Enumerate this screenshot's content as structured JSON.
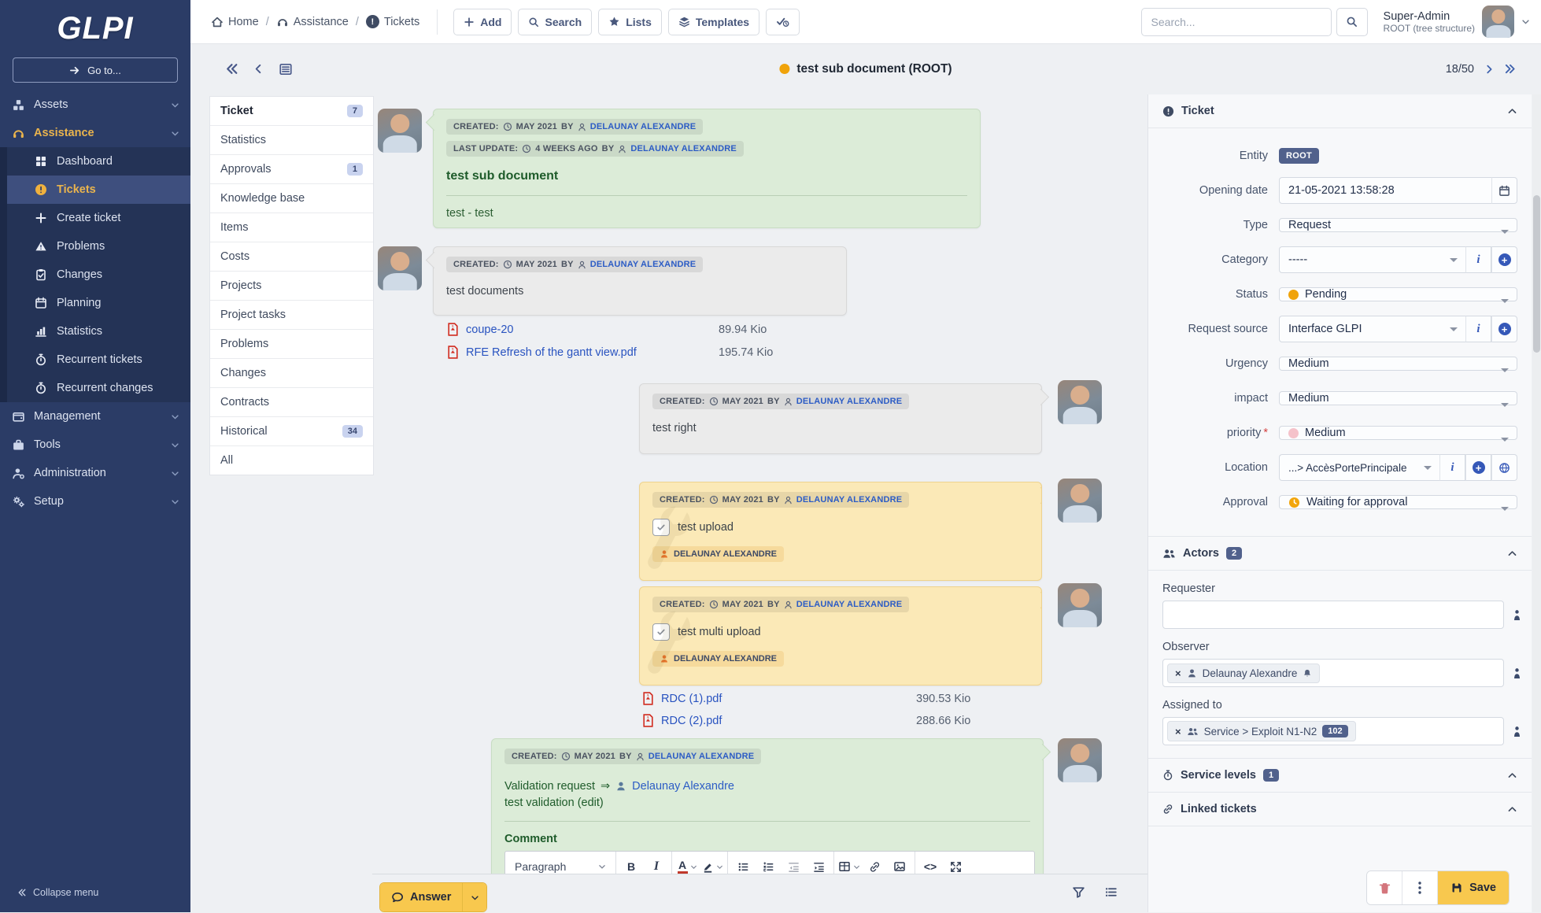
{
  "colors": {
    "accent_orange": "#f0a30a",
    "priority_pink": "#f5c2ca",
    "save_yellow": "#f8c84e",
    "link_blue": "#2c5cc5",
    "sidebar_navy": "#2b3c66",
    "green_text": "#1e5b2a"
  },
  "sidebar": {
    "logo": "GLPI",
    "goto": "Go to...",
    "collapse": "Collapse menu",
    "items": [
      {
        "label": "Assets",
        "icon": "boxes-icon"
      },
      {
        "label": "Assistance",
        "icon": "headset-icon"
      },
      {
        "label": "Management",
        "icon": "wallet-icon"
      },
      {
        "label": "Tools",
        "icon": "briefcase-icon"
      },
      {
        "label": "Administration",
        "icon": "person-gear-icon"
      },
      {
        "label": "Setup",
        "icon": "gears-icon"
      }
    ],
    "assistance_children": [
      {
        "label": "Dashboard",
        "icon": "grid-icon"
      },
      {
        "label": "Tickets",
        "icon": "exclamation-circle-icon"
      },
      {
        "label": "Create ticket",
        "icon": "plus-icon"
      },
      {
        "label": "Problems",
        "icon": "warning-icon"
      },
      {
        "label": "Changes",
        "icon": "clipboard-check-icon"
      },
      {
        "label": "Planning",
        "icon": "calendar-icon"
      },
      {
        "label": "Statistics",
        "icon": "bar-chart-icon"
      },
      {
        "label": "Recurrent tickets",
        "icon": "stopwatch-icon"
      },
      {
        "label": "Recurrent changes",
        "icon": "stopwatch-icon"
      }
    ]
  },
  "header": {
    "breadcrumb": [
      {
        "label": "Home",
        "icon": "home-icon"
      },
      {
        "label": "Assistance",
        "icon": "headset-icon"
      },
      {
        "label": "Tickets",
        "icon": "exclamation-circle-icon"
      }
    ],
    "buttons": [
      {
        "label": "Add",
        "icon": "plus-icon"
      },
      {
        "label": "Search",
        "icon": "search-icon"
      },
      {
        "label": "Lists",
        "icon": "star-icon"
      },
      {
        "label": "Templates",
        "icon": "layers-icon"
      }
    ],
    "search_placeholder": "Search...",
    "user_name": "Super-Admin",
    "user_context": "ROOT (tree structure)"
  },
  "titlebar": {
    "title": "test sub document (ROOT)",
    "pagination": "18/50"
  },
  "tabs": [
    {
      "label": "Ticket",
      "badge": "7"
    },
    {
      "label": "Statistics",
      "badge": ""
    },
    {
      "label": "Approvals",
      "badge": "1"
    },
    {
      "label": "Knowledge base",
      "badge": ""
    },
    {
      "label": "Items",
      "badge": ""
    },
    {
      "label": "Costs",
      "badge": ""
    },
    {
      "label": "Projects",
      "badge": ""
    },
    {
      "label": "Project tasks",
      "badge": ""
    },
    {
      "label": "Problems",
      "badge": ""
    },
    {
      "label": "Changes",
      "badge": ""
    },
    {
      "label": "Contracts",
      "badge": ""
    },
    {
      "label": "Historical",
      "badge": "34"
    },
    {
      "label": "All",
      "badge": ""
    }
  ],
  "meta": {
    "created": "CREATED:",
    "by": "BY",
    "last_update": "LAST UPDATE:",
    "time_created": "MAY 2021",
    "time_update": "4 WEEKS AGO",
    "author": "DELAUNAY ALEXANDRE"
  },
  "cards": {
    "doc": {
      "title": "test sub document",
      "body": "test - test"
    },
    "documents": {
      "body": "test documents",
      "a1_name": "coupe-20",
      "a1_size": "89.94 Kio",
      "a2_name": "RFE Refresh of the gantt view.pdf",
      "a2_size": "195.74 Kio"
    },
    "right": {
      "body": "test right"
    },
    "task1": {
      "body": "test upload",
      "footer": "DELAUNAY ALEXANDRE"
    },
    "task2": {
      "body": "test multi upload",
      "footer": "DELAUNAY ALEXANDRE",
      "a1_name": "RDC (1).pdf",
      "a1_size": "390.53 Kio",
      "a2_name": "RDC (2).pdf",
      "a2_size": "288.66 Kio"
    },
    "validation": {
      "line1": "Validation request",
      "arrow": "⇒",
      "target": "Delaunay Alexandre",
      "line2": "test validation (edit)",
      "comment": "Comment"
    }
  },
  "editor": {
    "paragraph": "Paragraph"
  },
  "actions": {
    "answer": "Answer",
    "save": "Save"
  },
  "panel": {
    "ticket": {
      "title": "Ticket",
      "entity_label": "Entity",
      "entity": "ROOT",
      "opening_label": "Opening date",
      "opening": "21-05-2021 13:58:28",
      "type_label": "Type",
      "type": "Request",
      "category_label": "Category",
      "category": "-----",
      "status_label": "Status",
      "status": "Pending",
      "source_label": "Request source",
      "source": "Interface GLPI",
      "urgency_label": "Urgency",
      "urgency": "Medium",
      "impact_label": "impact",
      "impact": "Medium",
      "priority_label": "priority",
      "priority": "Medium",
      "priority_required": "*",
      "location_label": "Location",
      "location": "...> AccèsPortePrincipale",
      "approval_label": "Approval",
      "approval": "Waiting for approval"
    },
    "actors": {
      "title": "Actors",
      "badge": "2",
      "requester_label": "Requester",
      "observer_label": "Observer",
      "assigned_label": "Assigned to",
      "observer_chip": "Delaunay Alexandre",
      "assigned_chip": "Service > Exploit N1-N2",
      "assigned_badge": "102",
      "remove": "×"
    },
    "service": {
      "title": "Service levels",
      "badge": "1"
    },
    "linked": {
      "title": "Linked tickets"
    }
  }
}
